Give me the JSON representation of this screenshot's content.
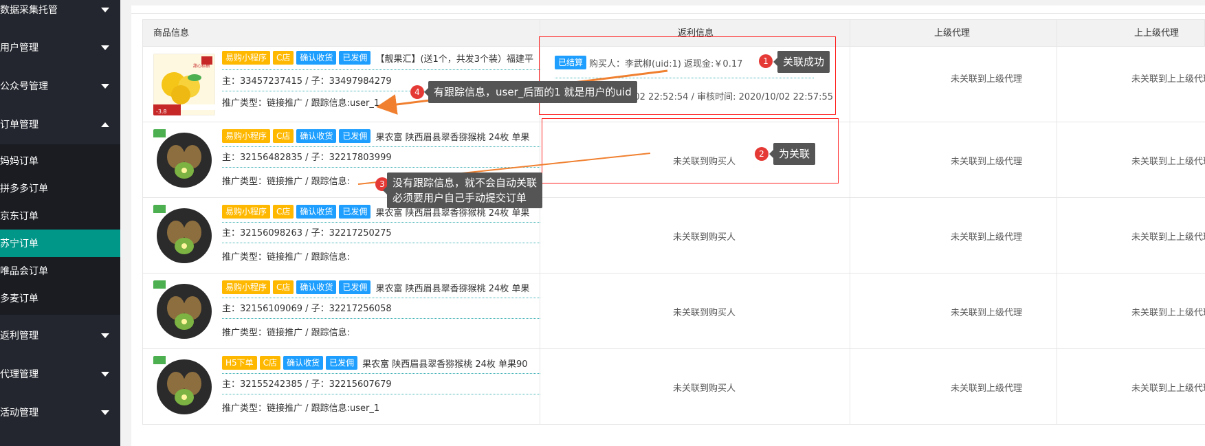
{
  "sidebar": {
    "top_menu": [
      {
        "label": "数据采集托管",
        "expanded": false
      },
      {
        "label": "用户管理",
        "expanded": false
      },
      {
        "label": "公众号管理",
        "expanded": false
      },
      {
        "label": "订单管理",
        "expanded": true
      }
    ],
    "order_submenu": [
      {
        "label": "妈妈订单",
        "active": false
      },
      {
        "label": "拼多多订单",
        "active": false
      },
      {
        "label": "京东订单",
        "active": false
      },
      {
        "label": "苏宁订单",
        "active": true
      },
      {
        "label": "唯品会订单",
        "active": false
      },
      {
        "label": "多麦订单",
        "active": false
      }
    ],
    "bottom_menu": [
      {
        "label": "返利管理"
      },
      {
        "label": "代理管理"
      },
      {
        "label": "活动管理"
      }
    ]
  },
  "table": {
    "headers": [
      "商品信息",
      "返利信息",
      "上级代理",
      "上上级代理"
    ],
    "rows": [
      {
        "tags": [
          "易购小程序",
          "C店",
          "确认收货",
          "已发佣"
        ],
        "title": "【靓果汇】(送1个，共发3个装）福建平",
        "ids": "主：33457237415 / 子：33497984279",
        "track": "推广类型：链接推广 / 跟踪信息:user_1",
        "rebate_tag": "已结算",
        "rebate_line": "购买人：李武柳(uid:1) 返现金:￥0.17",
        "rebate_time": "申请时间:2020-10-02 22:52:54 / 审核时间: 2020/10/02 22:57:55",
        "parent": "未关联到上级代理",
        "grandparent": "未关联到上上级代理"
      },
      {
        "tags": [
          "易购小程序",
          "C店",
          "确认收货",
          "已发佣"
        ],
        "title": "果农富 陕西眉县翠香猕猴桃 24枚 单果",
        "ids": "主：32156482835 / 子：32217803999",
        "track": "推广类型：链接推广 / 跟踪信息:",
        "rebate": "未关联到购买人",
        "parent": "未关联到上级代理",
        "grandparent": "未关联到上上级代理"
      },
      {
        "tags": [
          "易购小程序",
          "C店",
          "确认收货",
          "已发佣"
        ],
        "title": "果农富 陕西眉县翠香猕猴桃 24枚 单果",
        "ids": "主：32156098263 / 子：32217250275",
        "track": "推广类型：链接推广 / 跟踪信息:",
        "rebate": "未关联到购买人",
        "parent": "未关联到上级代理",
        "grandparent": "未关联到上上级代理"
      },
      {
        "tags": [
          "易购小程序",
          "C店",
          "确认收货",
          "已发佣"
        ],
        "title": "果农富 陕西眉县翠香猕猴桃 24枚 单果",
        "ids": "主：32156109069 / 子：32217256058",
        "track": "推广类型：链接推广 / 跟踪信息:",
        "rebate": "未关联到购买人",
        "parent": "未关联到上级代理",
        "grandparent": "未关联到上上级代理"
      },
      {
        "tags": [
          "H5下单",
          "C店",
          "确认收货",
          "已发佣"
        ],
        "title": "果农富 陕西眉县翠香猕猴桃 24枚 单果90-",
        "ids": "主：32155242385 / 子：32215607679",
        "track": "推广类型：链接推广 / 跟踪信息:user_1",
        "rebate": "未关联到购买人",
        "parent": "未关联到上级代理",
        "grandparent": "未关联到上上级代理"
      }
    ]
  },
  "annotations": {
    "a1": {
      "num": "1",
      "text": "关联成功"
    },
    "a2": {
      "num": "2",
      "text": "为关联"
    },
    "a3": {
      "num": "3",
      "line1": "没有跟踪信息，就不会自动关联",
      "line2": "必须要用户自己手动提交订单"
    },
    "a4": {
      "num": "4",
      "text": "有跟踪信息，user_后面的1 就是用户的uid"
    }
  },
  "colors": {
    "sidebar_bg": "#23262e",
    "active_item": "#009688",
    "tag_orange": "#ffb800",
    "tag_blue": "#1e9fff",
    "annotation_red": "#ff2222",
    "arrow_orange": "#f08030"
  },
  "icons": {
    "collapse_arrow": "chevron-down-icon",
    "expand_arrow": "chevron-up-icon"
  }
}
